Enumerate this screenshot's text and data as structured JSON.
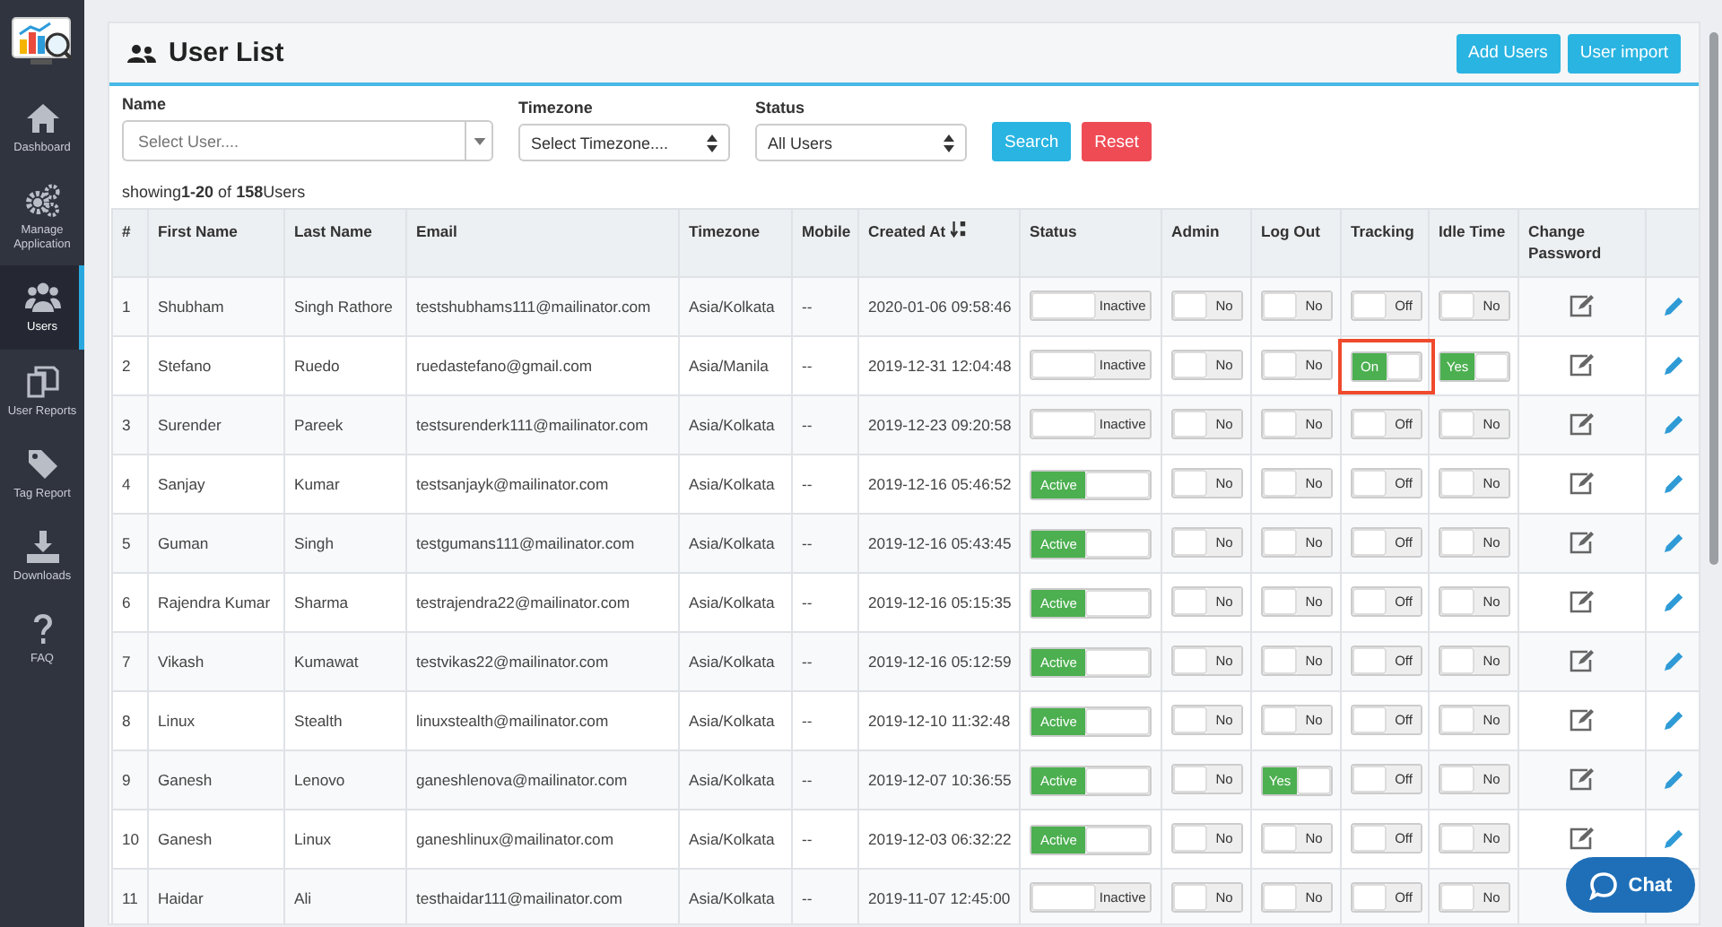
{
  "sidebar": {
    "items": [
      {
        "label": "Dashboard",
        "selected": false
      },
      {
        "label": "Manage Application",
        "selected": false
      },
      {
        "label": "Users",
        "selected": true
      },
      {
        "label": "User Reports",
        "selected": false
      },
      {
        "label": "Tag Report",
        "selected": false
      },
      {
        "label": "Downloads",
        "selected": false
      },
      {
        "label": "FAQ",
        "selected": false
      }
    ]
  },
  "page": {
    "title": "User List",
    "buttons": [
      "Add Users",
      "User import"
    ]
  },
  "filters": {
    "name": {
      "label": "Name",
      "placeholder": "Select User...."
    },
    "timezone": {
      "label": "Timezone",
      "value": "Select Timezone...."
    },
    "status": {
      "label": "Status",
      "value": "All Users"
    },
    "buttons": [
      {
        "label": "Search",
        "kind": "primary"
      },
      {
        "label": "Reset",
        "kind": "danger"
      }
    ]
  },
  "summary": "showing**1-20** of **158**Users",
  "table": {
    "columns": [
      {
        "label": "#"
      },
      {
        "label": "First Name"
      },
      {
        "label": "Last Name"
      },
      {
        "label": "Email"
      },
      {
        "label": "Timezone"
      },
      {
        "label": "Mobile"
      },
      {
        "label": "Created At",
        "sorted": true
      },
      {
        "label": "Status"
      },
      {
        "label": "Admin"
      },
      {
        "label": "Log Out"
      },
      {
        "label": "Tracking"
      },
      {
        "label": "Idle Time"
      },
      {
        "label": "Change Password"
      }
    ],
    "rows": [
      {
        "cells": [
          "1",
          "Shubham",
          "Singh Rathore",
          "testshubhams111@mailinator.com",
          "Asia/Kolkata",
          "--",
          "2020-01-06 09:58:46"
        ],
        "toggles": [
          {
            "label": "Inactive",
            "on": false
          },
          {
            "label": "No",
            "on": false
          },
          {
            "label": "No",
            "on": false
          },
          {
            "label": "Off",
            "on": false
          },
          {
            "label": "No",
            "on": false
          }
        ],
        "actions": true
      },
      {
        "cells": [
          "2",
          "Stefano",
          "Ruedo",
          "ruedastefano@gmail.com",
          "Asia/Manila",
          "--",
          "2019-12-31 12:04:48"
        ],
        "toggles": [
          {
            "label": "Inactive",
            "on": false
          },
          {
            "label": "No",
            "on": false
          },
          {
            "label": "No",
            "on": false
          },
          {
            "label": "On",
            "on": true,
            "highlighted": true
          },
          {
            "label": "Yes",
            "on": true
          }
        ],
        "actions": true
      },
      {
        "cells": [
          "3",
          "Surender",
          "Pareek",
          "testsurenderk111@mailinator.com",
          "Asia/Kolkata",
          "--",
          "2019-12-23 09:20:58"
        ],
        "toggles": [
          {
            "label": "Inactive",
            "on": false
          },
          {
            "label": "No",
            "on": false
          },
          {
            "label": "No",
            "on": false
          },
          {
            "label": "Off",
            "on": false
          },
          {
            "label": "No",
            "on": false
          }
        ],
        "actions": true
      },
      {
        "cells": [
          "4",
          "Sanjay",
          "Kumar",
          "testsanjayk@mailinator.com",
          "Asia/Kolkata",
          "--",
          "2019-12-16 05:46:52"
        ],
        "toggles": [
          {
            "label": "Active",
            "on": true
          },
          {
            "label": "No",
            "on": false
          },
          {
            "label": "No",
            "on": false
          },
          {
            "label": "Off",
            "on": false
          },
          {
            "label": "No",
            "on": false
          }
        ],
        "actions": true
      },
      {
        "cells": [
          "5",
          "Guman",
          "Singh",
          "testgumans111@mailinator.com",
          "Asia/Kolkata",
          "--",
          "2019-12-16 05:43:45"
        ],
        "toggles": [
          {
            "label": "Active",
            "on": true
          },
          {
            "label": "No",
            "on": false
          },
          {
            "label": "No",
            "on": false
          },
          {
            "label": "Off",
            "on": false
          },
          {
            "label": "No",
            "on": false
          }
        ],
        "actions": true
      },
      {
        "cells": [
          "6",
          "Rajendra Kumar",
          "Sharma",
          "testrajendra22@mailinator.com",
          "Asia/Kolkata",
          "--",
          "2019-12-16 05:15:35"
        ],
        "toggles": [
          {
            "label": "Active",
            "on": true
          },
          {
            "label": "No",
            "on": false
          },
          {
            "label": "No",
            "on": false
          },
          {
            "label": "Off",
            "on": false
          },
          {
            "label": "No",
            "on": false
          }
        ],
        "actions": true
      },
      {
        "cells": [
          "7",
          "Vikash",
          "Kumawat",
          "testvikas22@mailinator.com",
          "Asia/Kolkata",
          "--",
          "2019-12-16 05:12:59"
        ],
        "toggles": [
          {
            "label": "Active",
            "on": true
          },
          {
            "label": "No",
            "on": false
          },
          {
            "label": "No",
            "on": false
          },
          {
            "label": "Off",
            "on": false
          },
          {
            "label": "No",
            "on": false
          }
        ],
        "actions": true
      },
      {
        "cells": [
          "8",
          "Linux",
          "Stealth",
          "linuxstealth@mailinator.com",
          "Asia/Kolkata",
          "--",
          "2019-12-10 11:32:48"
        ],
        "toggles": [
          {
            "label": "Active",
            "on": true
          },
          {
            "label": "No",
            "on": false
          },
          {
            "label": "No",
            "on": false
          },
          {
            "label": "Off",
            "on": false
          },
          {
            "label": "No",
            "on": false
          }
        ],
        "actions": true
      },
      {
        "cells": [
          "9",
          "Ganesh",
          "Lenovo",
          "ganeshlenova@mailinator.com",
          "Asia/Kolkata",
          "--",
          "2019-12-07 10:36:55"
        ],
        "toggles": [
          {
            "label": "Active",
            "on": true
          },
          {
            "label": "No",
            "on": false
          },
          {
            "label": "Yes",
            "on": true
          },
          {
            "label": "Off",
            "on": false
          },
          {
            "label": "No",
            "on": false
          }
        ],
        "actions": true
      },
      {
        "cells": [
          "10",
          "Ganesh",
          "Linux",
          "ganeshlinux@mailinator.com",
          "Asia/Kolkata",
          "--",
          "2019-12-03 06:32:22"
        ],
        "toggles": [
          {
            "label": "Active",
            "on": true
          },
          {
            "label": "No",
            "on": false
          },
          {
            "label": "No",
            "on": false
          },
          {
            "label": "Off",
            "on": false
          },
          {
            "label": "No",
            "on": false
          }
        ],
        "actions": true
      },
      {
        "cells": [
          "11",
          "Haidar",
          "Ali",
          "testhaidar111@mailinator.com",
          "Asia/Kolkata",
          "--",
          "2019-11-07 12:45:00"
        ],
        "toggles": [
          {
            "label": "Inactive",
            "on": false
          },
          {
            "label": "No",
            "on": false
          },
          {
            "label": "No",
            "on": false
          },
          {
            "label": "Off",
            "on": false
          },
          {
            "label": "No",
            "on": false
          }
        ],
        "actions": false
      }
    ]
  },
  "chat": {
    "label": "Chat"
  }
}
